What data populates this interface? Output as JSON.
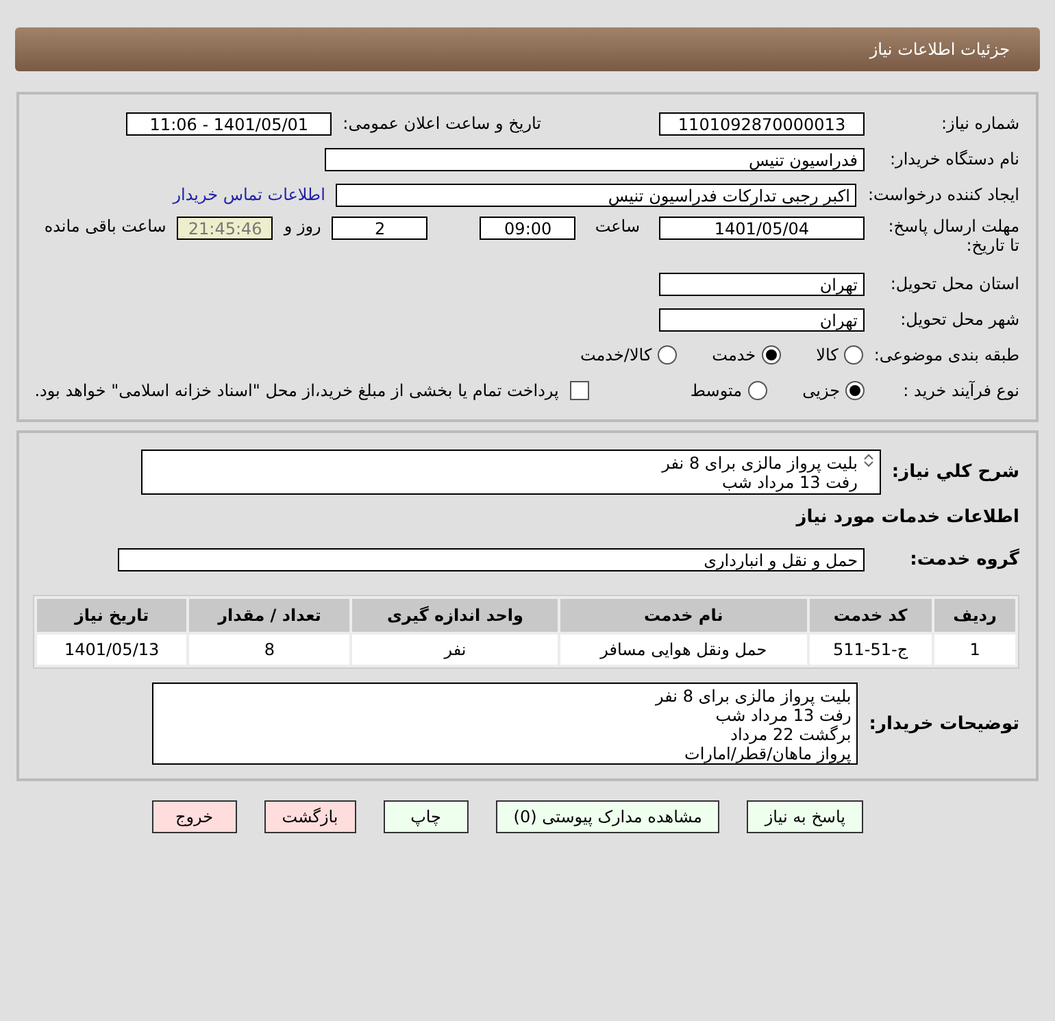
{
  "header": {
    "title": "جزئیات اطلاعات نیاز"
  },
  "details": {
    "need_number": {
      "label": "شماره نیاز:",
      "value": "1101092870000013"
    },
    "announce": {
      "label": "تاریخ و ساعت اعلان عمومی:",
      "value": "1401/05/01 - 11:06"
    },
    "buyer_org": {
      "label": "نام دستگاه خریدار:",
      "value": "فدراسیون تنیس"
    },
    "requester": {
      "label": "ایجاد کننده درخواست:",
      "value": "اکبر رجبی تدارکات فدراسیون تنیس",
      "link": "اطلاعات تماس خریدار"
    },
    "deadline": {
      "label": "مهلت ارسال پاسخ: تا تاریخ:",
      "date": "1401/05/04",
      "time_label": "ساعت",
      "time": "09:00",
      "days": "2",
      "days_label": "روز و",
      "remaining": "21:45:46",
      "remaining_label": "ساعت باقی مانده"
    },
    "province": {
      "label": "استان محل تحویل:",
      "value": "تهران"
    },
    "city": {
      "label": "شهر محل تحویل:",
      "value": "تهران"
    },
    "category": {
      "label": "طبقه بندی موضوعی:",
      "options": [
        {
          "label": "کالا",
          "selected": false
        },
        {
          "label": "خدمت",
          "selected": true
        },
        {
          "label": "کالا/خدمت",
          "selected": false
        }
      ]
    },
    "purchase_type": {
      "label": "نوع فرآیند خرید :",
      "options": [
        {
          "label": "جزیی",
          "selected": true
        },
        {
          "label": "متوسط",
          "selected": false
        }
      ],
      "payment_checkbox": {
        "checked": false,
        "label": "پرداخت تمام یا بخشی از مبلغ خرید،از محل \"اسناد خزانه اسلامی\" خواهد بود."
      }
    }
  },
  "services": {
    "summary": {
      "label": "شرح کلي نياز:",
      "lines": [
        "بلیت پرواز مالزی برای 8 نفر",
        "رفت 13 مرداد شب"
      ]
    },
    "heading": "اطلاعات خدمات مورد نیاز",
    "group": {
      "label": "گروه خدمت:",
      "value": "حمل و نقل و انبارداری"
    },
    "table": {
      "columns": [
        "ردیف",
        "کد خدمت",
        "نام خدمت",
        "واحد اندازه گیری",
        "تعداد / مقدار",
        "تاریخ نیاز"
      ],
      "rows": [
        [
          "1",
          "ج-51-511",
          "حمل ونقل هوایی مسافر",
          "نفر",
          "8",
          "1401/05/13"
        ]
      ]
    },
    "buyer_notes": {
      "label": "توضیحات خریدار:",
      "lines": [
        "بلیت پرواز مالزی برای 8 نفر",
        "رفت 13 مرداد شب",
        "برگشت 22 مرداد",
        "پرواز ماهان/قطر/امارات"
      ]
    }
  },
  "buttons": [
    {
      "label": "پاسخ به نیاز",
      "color": "#eeffee"
    },
    {
      "label": "مشاهده مدارک پیوستی (0)",
      "color": "#eeffee"
    },
    {
      "label": "چاپ",
      "color": "#eeffee"
    },
    {
      "label": "بازگشت",
      "color": "#ffdddd"
    },
    {
      "label": "خروج",
      "color": "#ffdddd"
    }
  ]
}
